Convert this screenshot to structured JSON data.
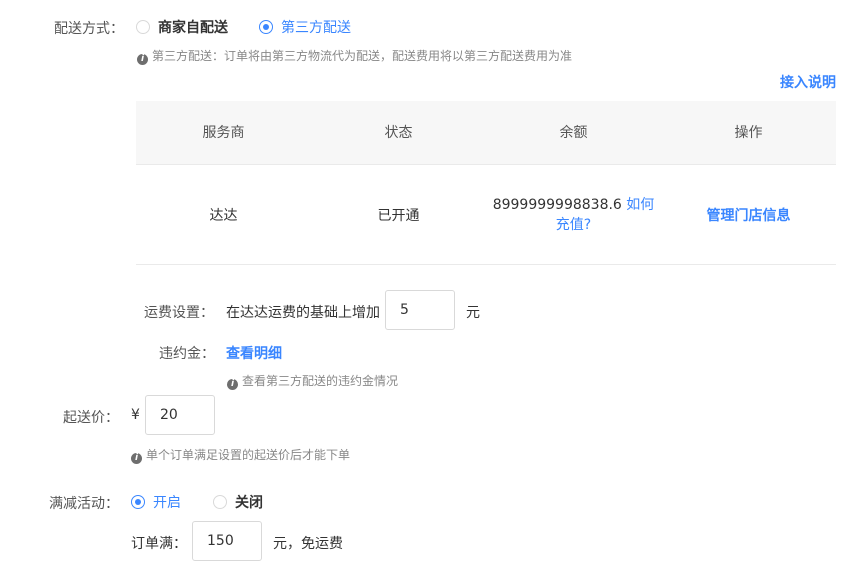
{
  "delivery": {
    "label": "配送方式：",
    "options": [
      {
        "label": "商家自配送",
        "selected": false
      },
      {
        "label": "第三方配送",
        "selected": true
      }
    ],
    "hint": "第三方配送：订单将由第三方物流代为配送，配送费用将以第三方配送费用为准",
    "access_link": "接入说明"
  },
  "table": {
    "headers": [
      "服务商",
      "状态",
      "余额",
      "操作"
    ],
    "rows": [
      {
        "provider": "达达",
        "status": "已开通",
        "balance": "8999999998838.6",
        "recharge_link_1": "如何",
        "recharge_link_2": "充值?",
        "action": "管理门店信息"
      }
    ]
  },
  "fee": {
    "label": "运费设置：",
    "text": "在达达运费的基础上增加",
    "value": "5",
    "unit": "元"
  },
  "penalty": {
    "label": "违约金：",
    "link": "查看明细",
    "hint": "查看第三方配送的违约金情况"
  },
  "min_price": {
    "label": "起送价：",
    "currency": "¥",
    "value": "20",
    "hint": "单个订单满足设置的起送价后才能下单"
  },
  "discount": {
    "label": "满减活动：",
    "options": [
      {
        "label": "开启",
        "selected": true
      },
      {
        "label": "关闭",
        "selected": false
      }
    ],
    "order_label": "订单满：",
    "order_value": "150",
    "order_suffix": "元，免运费"
  },
  "colors": {
    "accent": "#3a86ff",
    "header_bg": "#f7f7f7",
    "border": "#eaeaea"
  },
  "icons": {
    "info": "info-icon",
    "radio_on": "radio-selected-icon",
    "radio_off": "radio-unselected-icon"
  }
}
